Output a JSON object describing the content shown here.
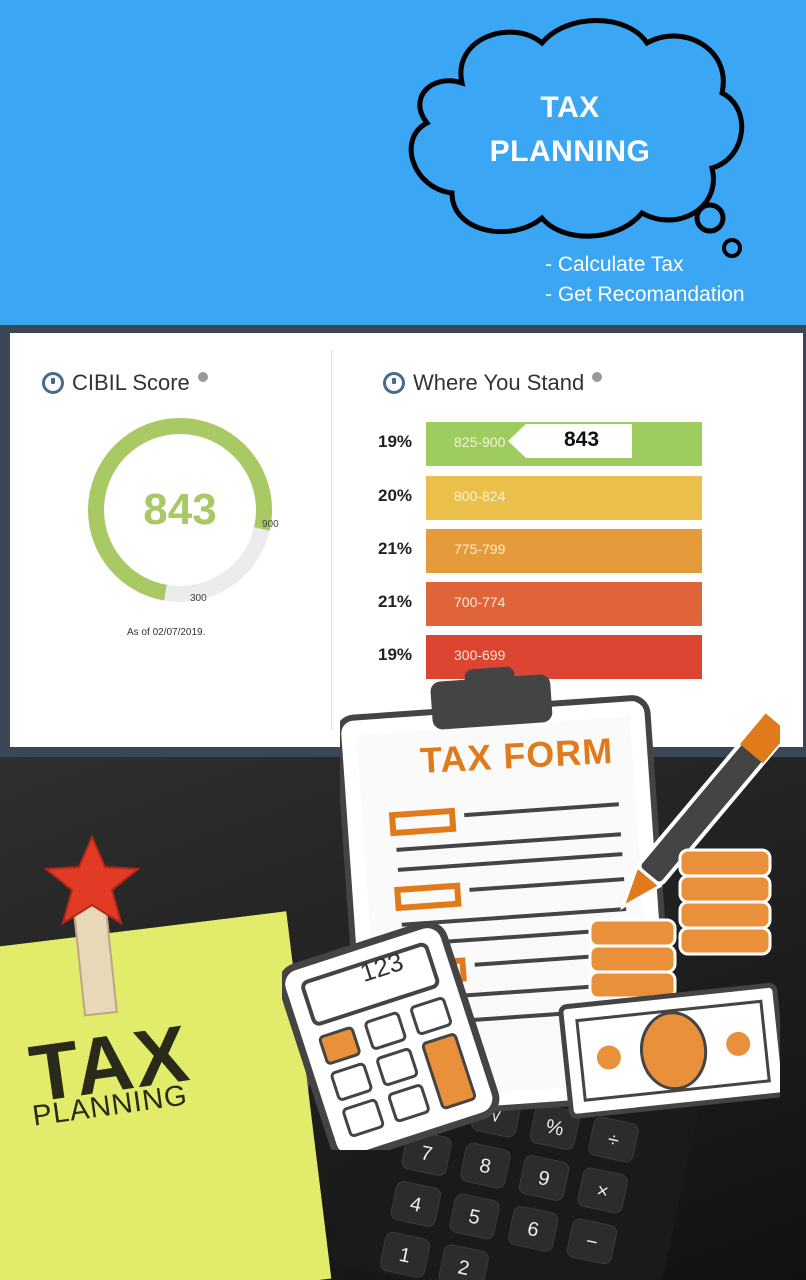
{
  "banner": {
    "title_line1": "TAX",
    "title_line2": "PLANNING",
    "bullets": [
      "- Calculate Tax",
      "- Get Recomandation"
    ],
    "background_color": "#3aa6f4"
  },
  "cibil": {
    "title": "CIBIL Score",
    "icon": "gauge-icon",
    "score": "843",
    "max": "900",
    "min": "300",
    "as_of": "As of 02/07/2019.",
    "score_fraction": 0.91,
    "accent_color": "#a8c964"
  },
  "stand": {
    "title": "Where You Stand",
    "icon": "clock-icon",
    "marker_score": "843",
    "bands": [
      {
        "pct": "19%",
        "range": "825-900",
        "color": "#9ecc5e"
      },
      {
        "pct": "20%",
        "range": "800-824",
        "color": "#ebc04a"
      },
      {
        "pct": "21%",
        "range": "775-799",
        "color": "#e59a3c"
      },
      {
        "pct": "21%",
        "range": "700-774",
        "color": "#e0643a"
      },
      {
        "pct": "19%",
        "range": "300-699",
        "color": "#db4532"
      }
    ]
  },
  "illustration": {
    "form_title": "TAX FORM",
    "mini_calc_display": "123",
    "sticky_title": "TAX",
    "sticky_subtitle": "PLANNING",
    "form_color": "#e07a1a"
  },
  "keypad": {
    "keys": [
      "√",
      "%",
      "÷",
      "7",
      "8",
      "9",
      "×",
      "4",
      "5",
      "6",
      "−",
      "1",
      "2"
    ]
  }
}
